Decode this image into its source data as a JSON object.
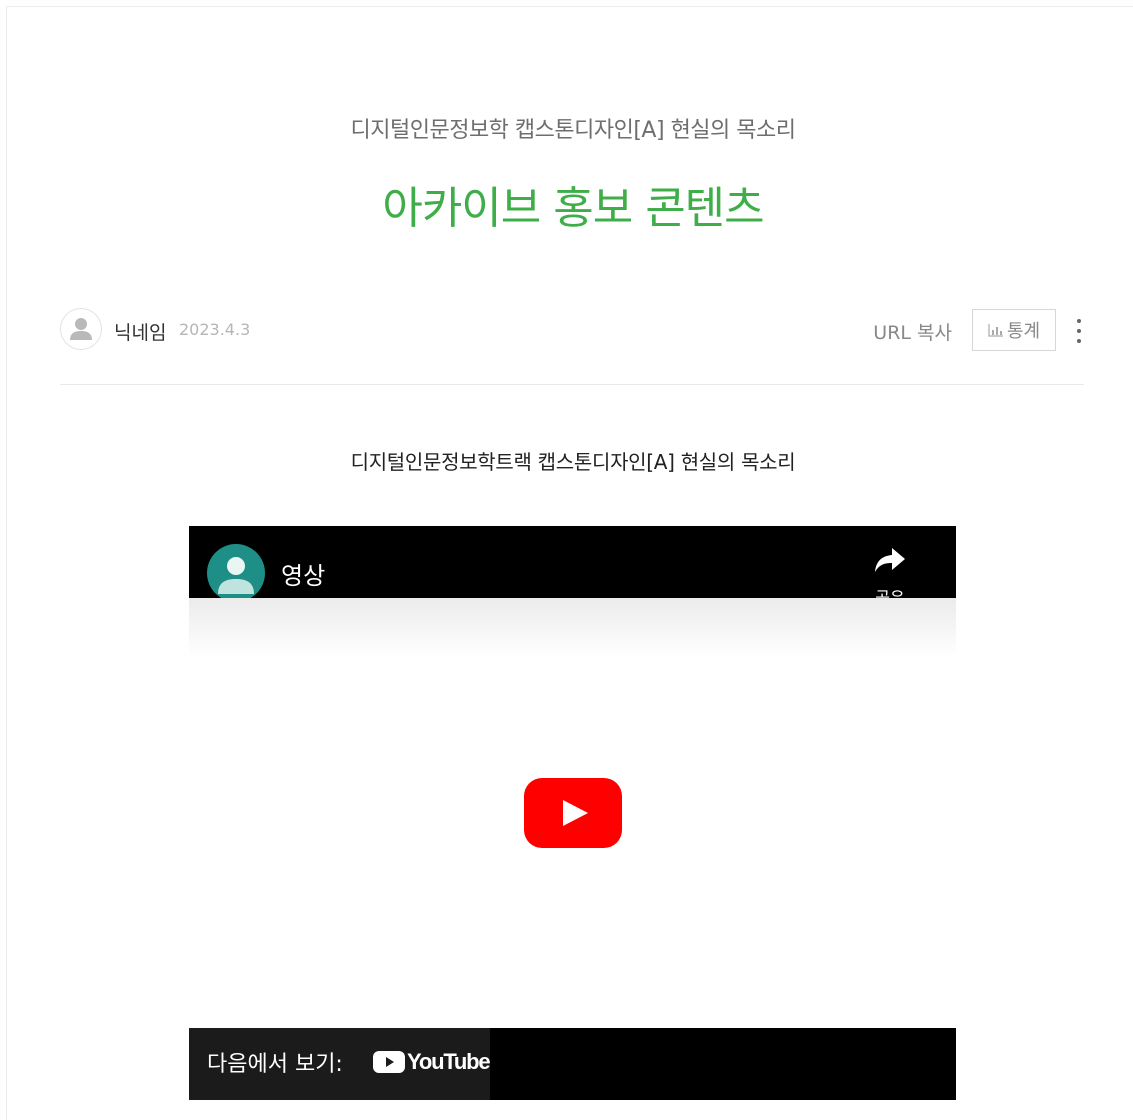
{
  "post": {
    "category": "디지털인문정보학 캡스톤디자인[A] 현실의 목소리",
    "title": "아카이브 홍보 콘텐츠",
    "author": "닉네임",
    "date": "2023.4.3",
    "url_copy_label": "URL 복사",
    "stats_label": "통계",
    "body_text": "디지털인문정보학트랙 캡스톤디자인[A] 현실의 목소리"
  },
  "video": {
    "title": "영상",
    "share_label": "공유",
    "watch_on_label": "다음에서 보기:",
    "platform_name": "YouTube"
  },
  "colors": {
    "title_accent": "#3fae49",
    "youtube_red": "#ff0000",
    "channel_avatar": "#1e8f86"
  },
  "icons": [
    "user-avatar-icon",
    "stats-chart-icon",
    "more-vertical-icon",
    "share-arrow-icon",
    "play-icon",
    "youtube-logo-icon"
  ]
}
